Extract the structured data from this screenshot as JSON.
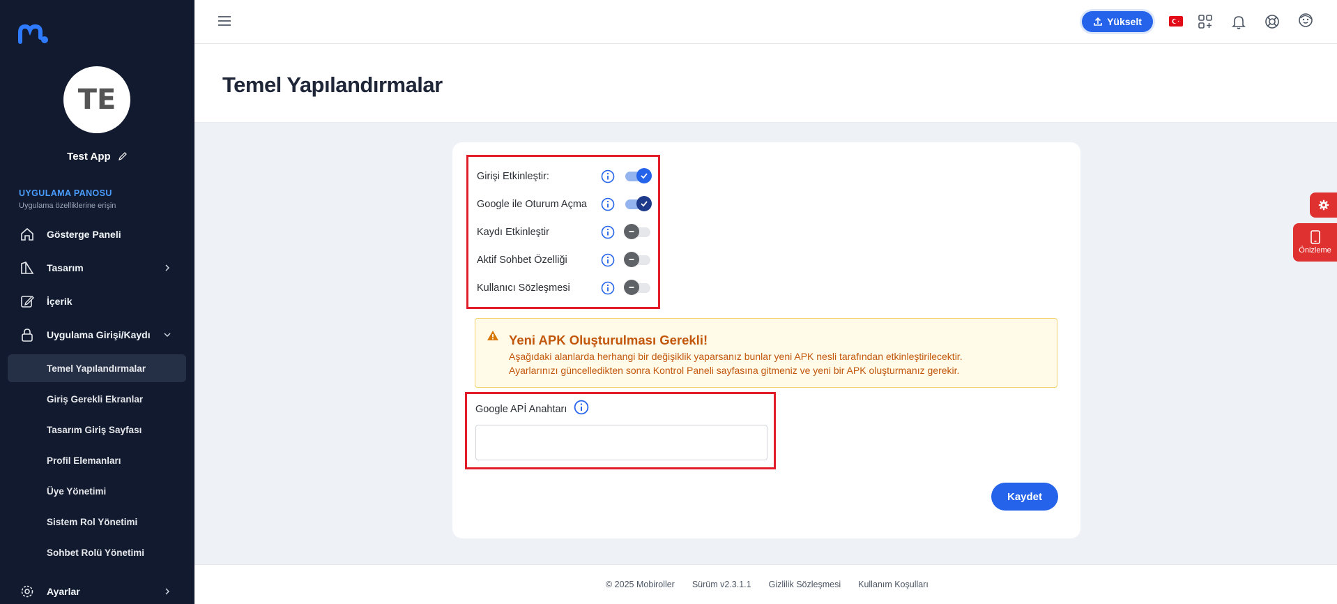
{
  "sidebar": {
    "avatar_initials": "TE",
    "app_name": "Test App",
    "section_title": "UYGULAMA PANOSU",
    "section_subtitle": "Uygulama özelliklerine erişin",
    "nav": [
      {
        "label": "Gösterge Paneli",
        "icon": "home-icon"
      },
      {
        "label": "Tasarım",
        "icon": "design-icon"
      },
      {
        "label": "İçerik",
        "icon": "edit-icon"
      },
      {
        "label": "Uygulama Girişi/Kaydı",
        "icon": "lock-icon"
      }
    ],
    "subnav": [
      {
        "label": "Temel Yapılandırmalar",
        "active": true
      },
      {
        "label": "Giriş Gerekli Ekranlar"
      },
      {
        "label": "Tasarım Giriş Sayfası"
      },
      {
        "label": "Profil Elemanları"
      },
      {
        "label": "Üye Yönetimi"
      },
      {
        "label": "Sistem Rol Yönetimi"
      },
      {
        "label": "Sohbet Rolü Yönetimi"
      }
    ],
    "settings_label": "Ayarlar"
  },
  "topbar": {
    "upgrade_label": "Yükselt",
    "colors": {
      "primary": "#2563eb",
      "flag": "#e30a17"
    }
  },
  "page": {
    "title": "Temel Yapılandırmalar"
  },
  "toggles": [
    {
      "label": "Girişi Etkinleştir:",
      "state": "on"
    },
    {
      "label": "Google ile Oturum Açma",
      "state": "on"
    },
    {
      "label": "Kaydı Etkinleştir",
      "state": "off"
    },
    {
      "label": "Aktif Sohbet Özelliği",
      "state": "off"
    },
    {
      "label": "Kullanıcı Sözleşmesi",
      "state": "off"
    }
  ],
  "alert": {
    "title": "Yeni APK Oluşturulması Gerekli!",
    "line1": "Aşağıdaki alanlarda herhangi bir değişiklik yaparsanız bunlar yeni APK nesli tarafından etkinleştirilecektir.",
    "line2": "Ayarlarınızı güncelledikten sonra Kontrol Paneli sayfasına gitmeniz ve yeni bir APK oluşturmanız gerekir."
  },
  "api": {
    "label": "Google APİ Anahtarı",
    "value": ""
  },
  "save_label": "Kaydet",
  "preview_label": "Önizleme",
  "footer": {
    "copyright": "© 2025 Mobiroller",
    "version": "Sürüm v2.3.1.1",
    "privacy": "Gizlilik Sözleşmesi",
    "terms": "Kullanım Koşulları"
  }
}
